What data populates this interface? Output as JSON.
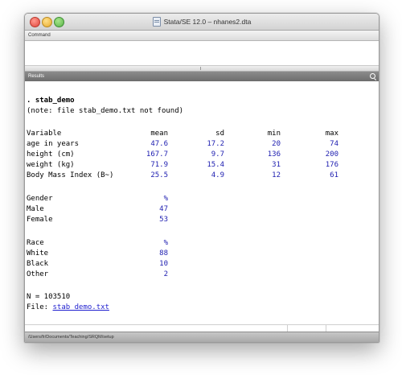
{
  "window": {
    "title": "Stata/SE 12.0 – nhanes2.dta"
  },
  "command_pane": {
    "label": "Command"
  },
  "results_pane": {
    "label": "Results",
    "command_line": ". stab_demo",
    "note": "(note: file stab_demo.txt not found)",
    "table_header": {
      "variable": "Variable",
      "mean": "mean",
      "sd": "sd",
      "min": "min",
      "max": "max"
    },
    "rows": [
      {
        "label": "age in years",
        "mean": "47.6",
        "sd": "17.2",
        "min": "20",
        "max": "74"
      },
      {
        "label": "height (cm)",
        "mean": "167.7",
        "sd": "9.7",
        "min": "136",
        "max": "200"
      },
      {
        "label": "weight (kg)",
        "mean": "71.9",
        "sd": "15.4",
        "min": "31",
        "max": "176"
      },
      {
        "label": "Body Mass Index (B~)",
        "mean": "25.5",
        "sd": "4.9",
        "min": "12",
        "max": "61"
      }
    ],
    "gender": {
      "label": "Gender",
      "pct_symbol": "%",
      "items": [
        {
          "label": "Male",
          "value": "47"
        },
        {
          "label": "Female",
          "value": "53"
        }
      ]
    },
    "race": {
      "label": "Race",
      "pct_symbol": "%",
      "items": [
        {
          "label": "White",
          "value": "88"
        },
        {
          "label": "Black",
          "value": "10"
        },
        {
          "label": "Other",
          "value": "2"
        }
      ]
    },
    "n_line": "N = 103510",
    "file_label": "File: ",
    "file_link": "stab_demo.txt",
    "prompt": "."
  },
  "status_bar": {
    "path": "/Users/fr/Documents/Teaching/SRQM/setup"
  },
  "colors": {
    "number_blue": "#1d1db0",
    "link_blue": "#1f1fcf",
    "results_header": "#7a7a7a"
  }
}
